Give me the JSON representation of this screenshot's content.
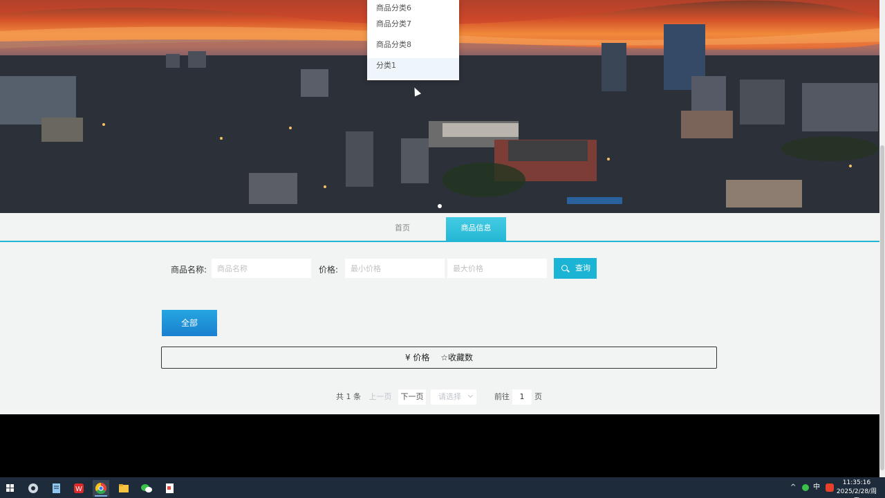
{
  "dropdown": {
    "items": [
      "商品分类6",
      "商品分类7",
      "商品分类8",
      "分类1"
    ]
  },
  "nav": {
    "home": "首页",
    "goods": "商品信息"
  },
  "search": {
    "name_label": "商品名称:",
    "name_placeholder": "商品名称",
    "price_label": "价格:",
    "min_placeholder": "最小价格",
    "max_placeholder": "最大价格",
    "button": "查询"
  },
  "filter": {
    "all_button": "全部"
  },
  "sort": {
    "price": "¥ 价格",
    "favorites": "☆收藏数"
  },
  "pagination": {
    "total": "共 1 条",
    "prev": "上一页",
    "next": "下一页",
    "page_size_placeholder": "请选择",
    "goto_label": "前往",
    "current_page": "1",
    "page_unit": "页"
  },
  "taskbar": {
    "tray_ime": "中",
    "time": "11:35:16",
    "date": "2025/2/28/周五"
  },
  "colors": {
    "accent": "#1cb4d4",
    "all_button": "#1f8fd8",
    "taskbar": "#1d2b3a"
  }
}
